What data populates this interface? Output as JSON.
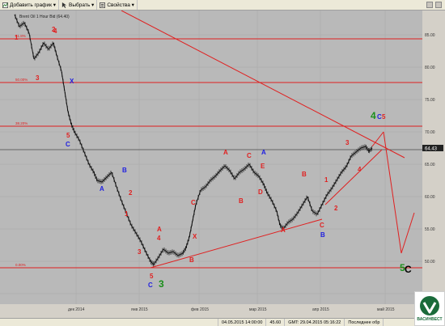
{
  "toolbar": {
    "add_chart": "Добавить график",
    "select": "Выбрать",
    "properties": "Свойства"
  },
  "chart": {
    "legend": "Brent Oil 1 Hour Bid (64.40)",
    "current_price": "64.43",
    "fib_labels": [
      "61.8%",
      "50.00%",
      "38.20%",
      "0.00%"
    ],
    "price_ticks": [
      "85.00",
      "80.00",
      "75.00",
      "70.00",
      "65.00",
      "60.00",
      "55.00",
      "50.00",
      "45.00"
    ],
    "date_ticks": [
      "дек 2014",
      "янв 2015",
      "фев 2015",
      "мар 2015",
      "апр 2015",
      "май 2015"
    ],
    "wave_labels": [
      {
        "text": "1",
        "color": "#e02020"
      },
      {
        "text": "2",
        "color": "#e02020"
      },
      {
        "text": "4",
        "color": "#e02020"
      },
      {
        "text": "3",
        "color": "#e02020"
      },
      {
        "text": "X",
        "color": "#2020e0"
      },
      {
        "text": "5",
        "color": "#e02020"
      },
      {
        "text": "C",
        "color": "#2020e0"
      },
      {
        "text": "B",
        "color": "#2020e0"
      },
      {
        "text": "A",
        "color": "#2020e0"
      },
      {
        "text": "2",
        "color": "#e02020"
      },
      {
        "text": "1",
        "color": "#e02020"
      },
      {
        "text": "4",
        "color": "#e02020"
      },
      {
        "text": "A",
        "color": "#e02020"
      },
      {
        "text": "3",
        "color": "#e02020"
      },
      {
        "text": "5",
        "color": "#e02020"
      },
      {
        "text": "C",
        "color": "#2020e0"
      },
      {
        "text": "3",
        "color": "#1a8f1a"
      },
      {
        "text": "B",
        "color": "#e02020"
      },
      {
        "text": "X",
        "color": "#e02020"
      },
      {
        "text": "C",
        "color": "#e02020"
      },
      {
        "text": "A",
        "color": "#e02020"
      },
      {
        "text": "B",
        "color": "#e02020"
      },
      {
        "text": "C",
        "color": "#e02020"
      },
      {
        "text": "E",
        "color": "#e02020"
      },
      {
        "text": "A",
        "color": "#2020e0"
      },
      {
        "text": "D",
        "color": "#e02020"
      },
      {
        "text": "A",
        "color": "#e02020"
      },
      {
        "text": "B",
        "color": "#e02020"
      },
      {
        "text": "1",
        "color": "#e02020"
      },
      {
        "text": "C",
        "color": "#e02020"
      },
      {
        "text": "B",
        "color": "#2020e0"
      },
      {
        "text": "2",
        "color": "#e02020"
      },
      {
        "text": "3",
        "color": "#e02020"
      },
      {
        "text": "4",
        "color": "#e02020"
      },
      {
        "text": "4",
        "color": "#1a8f1a"
      },
      {
        "text": "C",
        "color": "#2020e0"
      },
      {
        "text": "5",
        "color": "#e02020"
      },
      {
        "text": "5",
        "color": "#1a8f1a"
      },
      {
        "text": "C",
        "color": "#000000"
      }
    ]
  },
  "status": {
    "datetime": "04.05.2015 14:00:00",
    "value": "45.60",
    "gmt": "GMT: 29.04.2015 05:16:22",
    "last": "Последнее обр"
  },
  "logo": {
    "text": "ВАСИНВЕСТ"
  }
}
